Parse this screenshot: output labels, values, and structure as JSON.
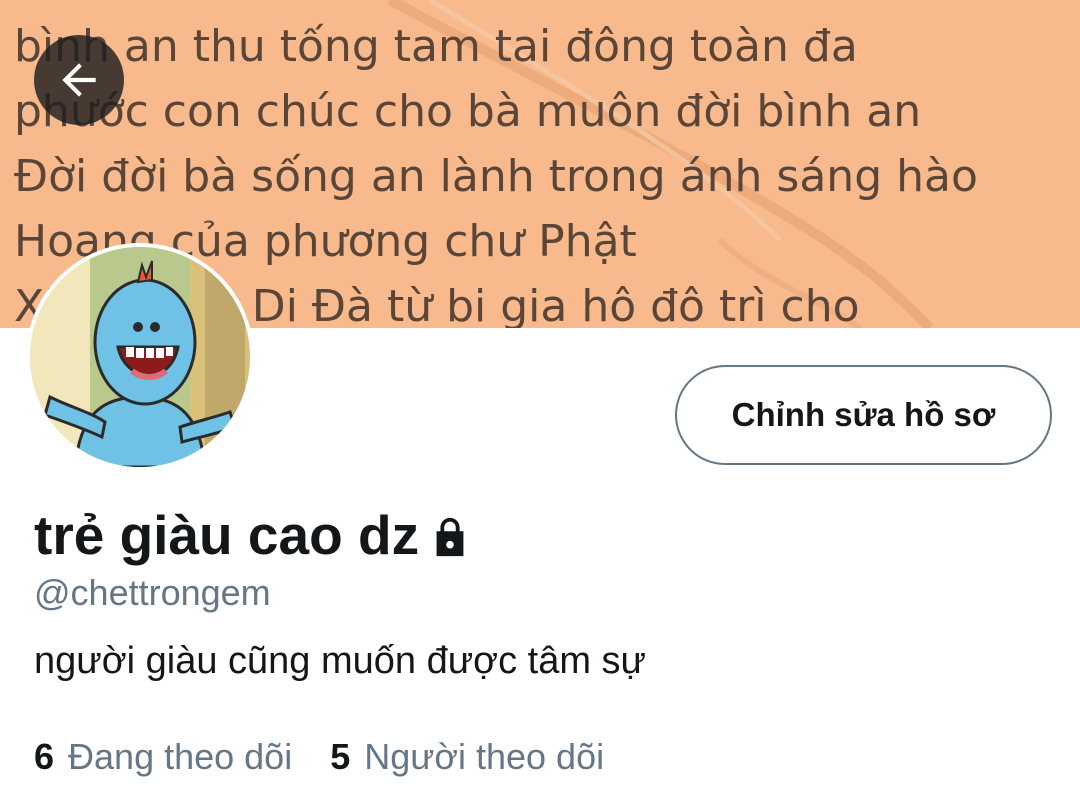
{
  "banner": {
    "lines": [
      "bình an thu tống tam tai đông toàn đa",
      "phước con chúc cho bà muôn đời bình an",
      "Đời đời bà sống an lành trong ánh sáng hào",
      "Hoang của phương chư Phật",
      "Xin Phật a Di Đà từ bi gia hô đô trì cho"
    ],
    "background_color": "#f8b98c"
  },
  "header": {
    "back_icon": "arrow-left-icon"
  },
  "profile": {
    "edit_profile_label": "Chỉnh sửa hồ sơ",
    "display_name": "trẻ giàu cao dz",
    "lock_icon": "lock-icon",
    "handle": "@chettrongem",
    "bio": "người giàu cũng muốn được tâm sự",
    "following_count": "6",
    "following_label": "Đang theo dõi",
    "followers_count": "5",
    "followers_label": "Người theo dõi"
  },
  "colors": {
    "primary_text": "#14171a",
    "secondary_text": "#657786"
  }
}
